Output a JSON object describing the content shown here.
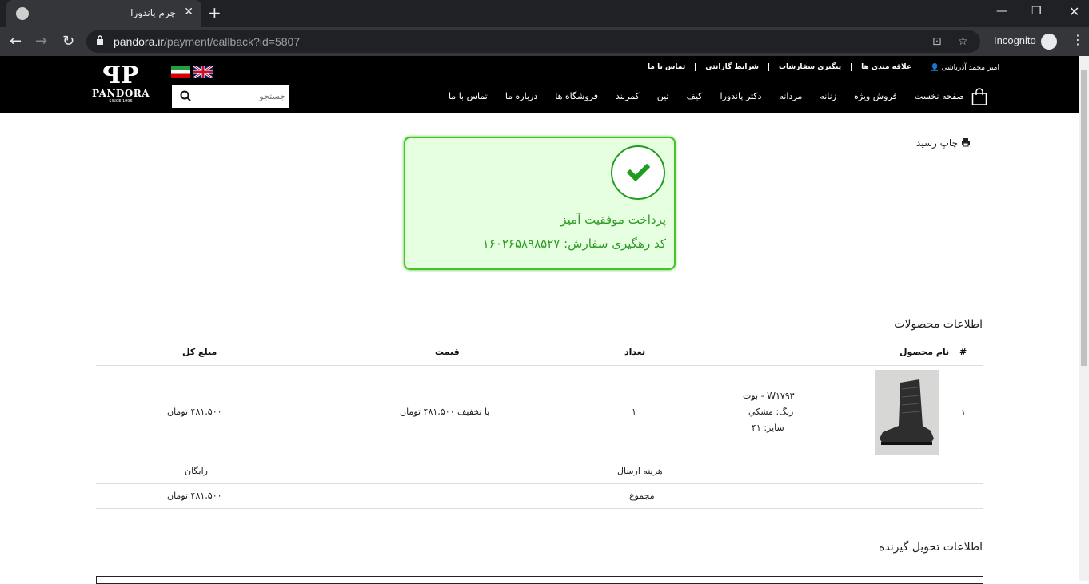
{
  "browser": {
    "tab_title": "چرم پاندورا",
    "url_domain": "pandora.ir",
    "url_path": "/payment/callback?id=5807",
    "incognito_label": "Incognito"
  },
  "header": {
    "user_name": "امیر محمد آذرباشی",
    "top_links": [
      "علاقه مندی ها",
      "پیگیری سفارشات",
      "شرایط گارانتی",
      "تماس با ما"
    ],
    "logo_name": "PANDORA",
    "logo_since": "SINCE 1996",
    "search_placeholder": "جستجو",
    "nav": [
      "صفحه نخست",
      "فروش ویژه",
      "زنانه",
      "مردانه",
      "دکتر پاندورا",
      "کیف",
      "تین",
      "کمربند",
      "فروشگاه ها",
      "درباره ما",
      "تماس با ما"
    ]
  },
  "payment": {
    "print_label": "چاپ رسید",
    "success_title": "پرداخت موفقیت آمیز",
    "tracking_label": "کد رهگیری سفارش: ۱۶۰۲۶۵۸۹۸۵۲۷"
  },
  "products": {
    "section_title": "اطلاعات محصولات",
    "headers": {
      "index": "#",
      "name": "نام محصول",
      "qty": "تعداد",
      "price": "قیمت",
      "total": "مبلغ کل"
    },
    "rows": [
      {
        "index": "۱",
        "name": "W۱۷۹۳ - بوت",
        "color": "رنگ: مشکي",
        "size": "سایز: ۴۱",
        "qty": "۱",
        "price": "با تخفیف ۴۸۱,۵۰۰ تومان",
        "total": "۴۸۱,۵۰۰ تومان"
      }
    ],
    "shipping_label": "هزینه ارسال",
    "shipping_value": "رایگان",
    "sum_label": "مجموع",
    "sum_value": "۴۸۱,۵۰۰ تومان"
  },
  "receiver": {
    "section_title": "اطلاعات تحویل گیرنده"
  }
}
